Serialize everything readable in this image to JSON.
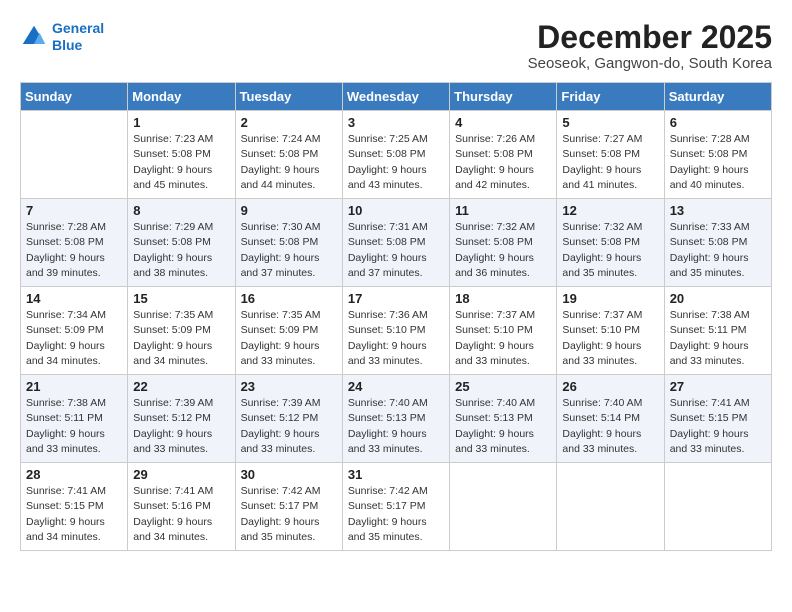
{
  "header": {
    "logo_line1": "General",
    "logo_line2": "Blue",
    "month_title": "December 2025",
    "location": "Seoseok, Gangwon-do, South Korea"
  },
  "weekdays": [
    "Sunday",
    "Monday",
    "Tuesday",
    "Wednesday",
    "Thursday",
    "Friday",
    "Saturday"
  ],
  "weeks": [
    [
      {
        "day": "",
        "info": ""
      },
      {
        "day": "1",
        "info": "Sunrise: 7:23 AM\nSunset: 5:08 PM\nDaylight: 9 hours\nand 45 minutes."
      },
      {
        "day": "2",
        "info": "Sunrise: 7:24 AM\nSunset: 5:08 PM\nDaylight: 9 hours\nand 44 minutes."
      },
      {
        "day": "3",
        "info": "Sunrise: 7:25 AM\nSunset: 5:08 PM\nDaylight: 9 hours\nand 43 minutes."
      },
      {
        "day": "4",
        "info": "Sunrise: 7:26 AM\nSunset: 5:08 PM\nDaylight: 9 hours\nand 42 minutes."
      },
      {
        "day": "5",
        "info": "Sunrise: 7:27 AM\nSunset: 5:08 PM\nDaylight: 9 hours\nand 41 minutes."
      },
      {
        "day": "6",
        "info": "Sunrise: 7:28 AM\nSunset: 5:08 PM\nDaylight: 9 hours\nand 40 minutes."
      }
    ],
    [
      {
        "day": "7",
        "info": "Sunrise: 7:28 AM\nSunset: 5:08 PM\nDaylight: 9 hours\nand 39 minutes."
      },
      {
        "day": "8",
        "info": "Sunrise: 7:29 AM\nSunset: 5:08 PM\nDaylight: 9 hours\nand 38 minutes."
      },
      {
        "day": "9",
        "info": "Sunrise: 7:30 AM\nSunset: 5:08 PM\nDaylight: 9 hours\nand 37 minutes."
      },
      {
        "day": "10",
        "info": "Sunrise: 7:31 AM\nSunset: 5:08 PM\nDaylight: 9 hours\nand 37 minutes."
      },
      {
        "day": "11",
        "info": "Sunrise: 7:32 AM\nSunset: 5:08 PM\nDaylight: 9 hours\nand 36 minutes."
      },
      {
        "day": "12",
        "info": "Sunrise: 7:32 AM\nSunset: 5:08 PM\nDaylight: 9 hours\nand 35 minutes."
      },
      {
        "day": "13",
        "info": "Sunrise: 7:33 AM\nSunset: 5:08 PM\nDaylight: 9 hours\nand 35 minutes."
      }
    ],
    [
      {
        "day": "14",
        "info": "Sunrise: 7:34 AM\nSunset: 5:09 PM\nDaylight: 9 hours\nand 34 minutes."
      },
      {
        "day": "15",
        "info": "Sunrise: 7:35 AM\nSunset: 5:09 PM\nDaylight: 9 hours\nand 34 minutes."
      },
      {
        "day": "16",
        "info": "Sunrise: 7:35 AM\nSunset: 5:09 PM\nDaylight: 9 hours\nand 33 minutes."
      },
      {
        "day": "17",
        "info": "Sunrise: 7:36 AM\nSunset: 5:10 PM\nDaylight: 9 hours\nand 33 minutes."
      },
      {
        "day": "18",
        "info": "Sunrise: 7:37 AM\nSunset: 5:10 PM\nDaylight: 9 hours\nand 33 minutes."
      },
      {
        "day": "19",
        "info": "Sunrise: 7:37 AM\nSunset: 5:10 PM\nDaylight: 9 hours\nand 33 minutes."
      },
      {
        "day": "20",
        "info": "Sunrise: 7:38 AM\nSunset: 5:11 PM\nDaylight: 9 hours\nand 33 minutes."
      }
    ],
    [
      {
        "day": "21",
        "info": "Sunrise: 7:38 AM\nSunset: 5:11 PM\nDaylight: 9 hours\nand 33 minutes."
      },
      {
        "day": "22",
        "info": "Sunrise: 7:39 AM\nSunset: 5:12 PM\nDaylight: 9 hours\nand 33 minutes."
      },
      {
        "day": "23",
        "info": "Sunrise: 7:39 AM\nSunset: 5:12 PM\nDaylight: 9 hours\nand 33 minutes."
      },
      {
        "day": "24",
        "info": "Sunrise: 7:40 AM\nSunset: 5:13 PM\nDaylight: 9 hours\nand 33 minutes."
      },
      {
        "day": "25",
        "info": "Sunrise: 7:40 AM\nSunset: 5:13 PM\nDaylight: 9 hours\nand 33 minutes."
      },
      {
        "day": "26",
        "info": "Sunrise: 7:40 AM\nSunset: 5:14 PM\nDaylight: 9 hours\nand 33 minutes."
      },
      {
        "day": "27",
        "info": "Sunrise: 7:41 AM\nSunset: 5:15 PM\nDaylight: 9 hours\nand 33 minutes."
      }
    ],
    [
      {
        "day": "28",
        "info": "Sunrise: 7:41 AM\nSunset: 5:15 PM\nDaylight: 9 hours\nand 34 minutes."
      },
      {
        "day": "29",
        "info": "Sunrise: 7:41 AM\nSunset: 5:16 PM\nDaylight: 9 hours\nand 34 minutes."
      },
      {
        "day": "30",
        "info": "Sunrise: 7:42 AM\nSunset: 5:17 PM\nDaylight: 9 hours\nand 35 minutes."
      },
      {
        "day": "31",
        "info": "Sunrise: 7:42 AM\nSunset: 5:17 PM\nDaylight: 9 hours\nand 35 minutes."
      },
      {
        "day": "",
        "info": ""
      },
      {
        "day": "",
        "info": ""
      },
      {
        "day": "",
        "info": ""
      }
    ]
  ]
}
